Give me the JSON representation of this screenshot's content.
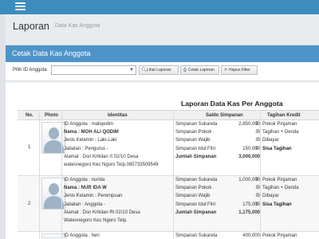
{
  "page": {
    "title": "Laporan",
    "subtitle": "Data Kas Anggota"
  },
  "panel": {
    "title": "Cetak Data Kas Anggota",
    "filter_label": "Pilih ID Anggota",
    "select_value": "",
    "btn_lihat": "Lihat Laporan",
    "btn_cetak": "Cetak Laporan",
    "btn_hapus": "Hapus Filter"
  },
  "report": {
    "title": "Laporan Data Kas Per Anggota",
    "columns": [
      "No.",
      "Photo",
      "Identitas",
      "Saldo Simpanan",
      "Tagihan Kredit"
    ],
    "rows": [
      {
        "no": "1",
        "identitas": [
          "ID Anggota : maliqodim",
          "Nama : MOH ALI QODIM",
          "Jenis Kelamin : Laki-Laki",
          "Jabatan : Pengurus -",
          "Alamat : Dsn Krikilan rt 02/10 Desa",
          "watesnegoro Kec Ngoro Telp.085733509549"
        ],
        "simpanan": [
          {
            "label": "Simpanan Sukarela",
            "value": "2,850,000"
          },
          {
            "label": "Simpanan Pokok",
            "value": "0"
          },
          {
            "label": "Simpanan Wajib",
            "value": "0"
          },
          {
            "label": "Simpanan Idul Fitri",
            "value": "150,000"
          },
          {
            "label": "Jumlah Simpanan",
            "value": "3,000,000"
          }
        ],
        "tagihan": [
          {
            "label": "Pokok Pinjaman",
            "value": "0"
          },
          {
            "label": "Tagihan + Denda",
            "value": "0"
          },
          {
            "label": "Dibayar",
            "value": "0"
          },
          {
            "label": "Sisa Tagihan",
            "value": "0"
          }
        ]
      },
      {
        "no": "2",
        "identitas": [
          "ID Anggota : nurida",
          "Nama : NUR IDA W",
          "Jenis Kelamin : Perempuan",
          "Jabatan : Anggota -",
          "Alamat : Dsn Krikilan Rt 02/10 Desa",
          "Watesnegoro Kec Ngoro Telp."
        ],
        "simpanan": [
          {
            "label": "Simpanan Sukarela",
            "value": "1,000,000"
          },
          {
            "label": "Simpanan Pokok",
            "value": "0"
          },
          {
            "label": "Simpanan Wajib",
            "value": "0"
          },
          {
            "label": "Simpanan Idul Fitri",
            "value": "175,000"
          },
          {
            "label": "Jumlah Simpanan",
            "value": "1,175,000"
          }
        ],
        "tagihan": [
          {
            "label": "Pokok Pinjaman",
            "value": "0"
          },
          {
            "label": "Tagihan + Denda",
            "value": "0"
          },
          {
            "label": "Dibayar",
            "value": "0"
          },
          {
            "label": "Sisa Tagihan",
            "value": "0"
          }
        ]
      },
      {
        "no": "",
        "identitas": [
          "ID Anggota : heri"
        ],
        "simpanan": [
          {
            "label": "Simpanan Sukarela",
            "value": "400,000"
          }
        ],
        "tagihan": [
          {
            "label": "Pokok Pinjaman",
            "value": "0"
          }
        ]
      }
    ]
  },
  "colors": {
    "topbar": "#3c8dbc",
    "panel_header": "#4f94c9"
  },
  "icons": [
    "menu-icon",
    "chevron-down-icon",
    "search-icon",
    "print-icon",
    "close-icon",
    "user-silhouette-icon"
  ]
}
